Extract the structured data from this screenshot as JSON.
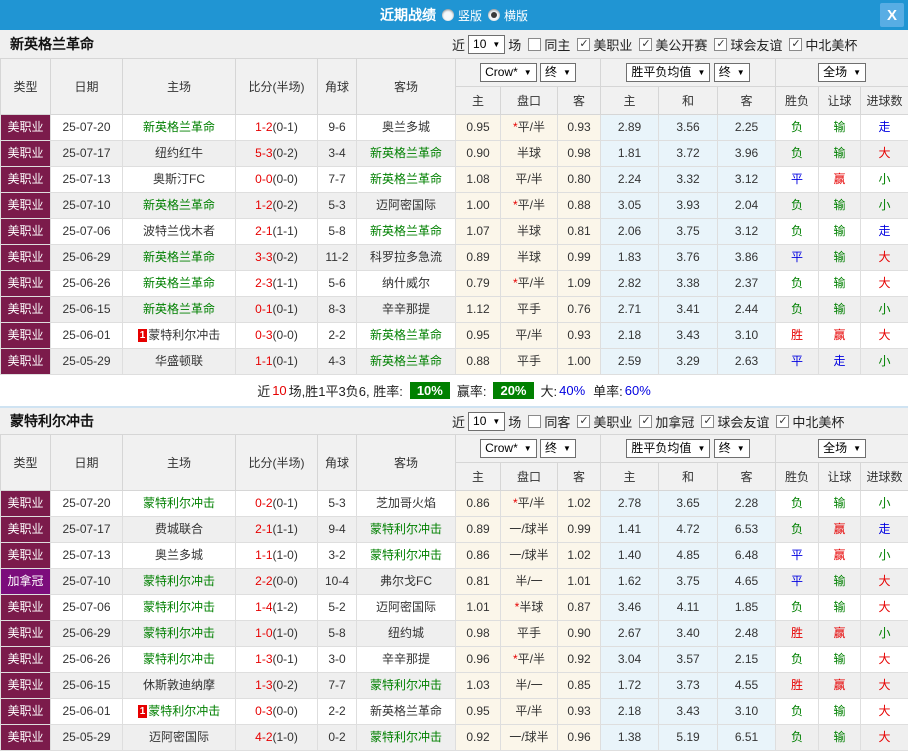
{
  "titlebar": {
    "title": "近期战绩",
    "radios": [
      {
        "label": "竖版",
        "selected": false
      },
      {
        "label": "横版",
        "selected": true
      }
    ],
    "close_label": "X"
  },
  "controls": {
    "bookmaker": "Crow*",
    "asia_final": "终",
    "europe_avg": "胜平负均值",
    "europe_final": "终",
    "scope": "全场"
  },
  "columns": {
    "type": "类型",
    "date": "日期",
    "home": "主场",
    "score": "比分(半场)",
    "corners": "角球",
    "away": "客场",
    "asia_sub": [
      "主",
      "盘口",
      "客"
    ],
    "europe_sub": [
      "主",
      "和",
      "客"
    ],
    "result_sub": [
      "胜负",
      "让球",
      "进球数"
    ]
  },
  "colors": {
    "topbar_blue": "#2095d3",
    "league_maroon": "#7b1b4b",
    "league_purple": "#7c0d7c",
    "team_green": "#008000",
    "score_red": "#e60000",
    "draw_blue": "#0000e0",
    "asia_bg": "#fbf6ea",
    "europe_bg": "#e9f4fa",
    "badge_green": "#008000"
  },
  "sections": [
    {
      "team": "新英格兰革命",
      "filters": {
        "near": "近",
        "count": "10",
        "unit": "场",
        "same_label": "同主",
        "same_checked": false,
        "leagues": [
          {
            "label": "美职业",
            "checked": true
          },
          {
            "label": "美公开赛",
            "checked": true
          },
          {
            "label": "球会友谊",
            "checked": true
          },
          {
            "label": "中北美杯",
            "checked": true
          }
        ]
      },
      "rows": [
        {
          "league": "美职业",
          "lc": "m",
          "date": "25-07-20",
          "home": "新英格兰革命",
          "hg": true,
          "hb": "",
          "away": "奥兰多城",
          "ag": false,
          "score": "1-2",
          "half": "(0-1)",
          "corners": "9-6",
          "ah": "0.95",
          "star": true,
          "line": "平/半",
          "aa": "0.93",
          "eh": "2.89",
          "ed": "3.56",
          "ea": "2.25",
          "res1": "负",
          "c1": "g",
          "res2": "输",
          "c2": "g",
          "res3": "走",
          "c3": "b"
        },
        {
          "league": "美职业",
          "lc": "m",
          "date": "25-07-17",
          "home": "纽约红牛",
          "hg": false,
          "hb": "",
          "away": "新英格兰革命",
          "ag": true,
          "score": "5-3",
          "half": "(0-2)",
          "corners": "3-4",
          "ah": "0.90",
          "star": false,
          "line": "半球",
          "aa": "0.98",
          "eh": "1.81",
          "ed": "3.72",
          "ea": "3.96",
          "res1": "负",
          "c1": "g",
          "res2": "输",
          "c2": "g",
          "res3": "大",
          "c3": "r"
        },
        {
          "league": "美职业",
          "lc": "m",
          "date": "25-07-13",
          "home": "奥斯汀FC",
          "hg": false,
          "hb": "",
          "away": "新英格兰革命",
          "ag": true,
          "score": "0-0",
          "half": "(0-0)",
          "corners": "7-7",
          "ah": "1.08",
          "star": false,
          "line": "平/半",
          "aa": "0.80",
          "eh": "2.24",
          "ed": "3.32",
          "ea": "3.12",
          "res1": "平",
          "c1": "b",
          "res2": "赢",
          "c2": "r",
          "res3": "小",
          "c3": "g"
        },
        {
          "league": "美职业",
          "lc": "m",
          "date": "25-07-10",
          "home": "新英格兰革命",
          "hg": true,
          "hb": "",
          "away": "迈阿密国际",
          "ag": false,
          "score": "1-2",
          "half": "(0-2)",
          "corners": "5-3",
          "ah": "1.00",
          "star": true,
          "line": "平/半",
          "aa": "0.88",
          "eh": "3.05",
          "ed": "3.93",
          "ea": "2.04",
          "res1": "负",
          "c1": "g",
          "res2": "输",
          "c2": "g",
          "res3": "小",
          "c3": "g"
        },
        {
          "league": "美职业",
          "lc": "m",
          "date": "25-07-06",
          "home": "波特兰伐木者",
          "hg": false,
          "hb": "",
          "away": "新英格兰革命",
          "ag": true,
          "score": "2-1",
          "half": "(1-1)",
          "corners": "5-8",
          "ah": "1.07",
          "star": false,
          "line": "半球",
          "aa": "0.81",
          "eh": "2.06",
          "ed": "3.75",
          "ea": "3.12",
          "res1": "负",
          "c1": "g",
          "res2": "输",
          "c2": "g",
          "res3": "走",
          "c3": "b"
        },
        {
          "league": "美职业",
          "lc": "m",
          "date": "25-06-29",
          "home": "新英格兰革命",
          "hg": true,
          "hb": "",
          "away": "科罗拉多急流",
          "ag": false,
          "score": "3-3",
          "half": "(0-2)",
          "corners": "11-2",
          "ah": "0.89",
          "star": false,
          "line": "半球",
          "aa": "0.99",
          "eh": "1.83",
          "ed": "3.76",
          "ea": "3.86",
          "res1": "平",
          "c1": "b",
          "res2": "输",
          "c2": "g",
          "res3": "大",
          "c3": "r"
        },
        {
          "league": "美职业",
          "lc": "m",
          "date": "25-06-26",
          "home": "新英格兰革命",
          "hg": true,
          "hb": "",
          "away": "纳什威尔",
          "ag": false,
          "score": "2-3",
          "half": "(1-1)",
          "corners": "5-6",
          "ah": "0.79",
          "star": true,
          "line": "平/半",
          "aa": "1.09",
          "eh": "2.82",
          "ed": "3.38",
          "ea": "2.37",
          "res1": "负",
          "c1": "g",
          "res2": "输",
          "c2": "g",
          "res3": "大",
          "c3": "r"
        },
        {
          "league": "美职业",
          "lc": "m",
          "date": "25-06-15",
          "home": "新英格兰革命",
          "hg": true,
          "hb": "",
          "away": "辛辛那提",
          "ag": false,
          "score": "0-1",
          "half": "(0-1)",
          "corners": "8-3",
          "ah": "1.12",
          "star": false,
          "line": "平手",
          "aa": "0.76",
          "eh": "2.71",
          "ed": "3.41",
          "ea": "2.44",
          "res1": "负",
          "c1": "g",
          "res2": "输",
          "c2": "g",
          "res3": "小",
          "c3": "g"
        },
        {
          "league": "美职业",
          "lc": "m",
          "date": "25-06-01",
          "home": "蒙特利尔冲击",
          "hg": false,
          "hb": "1",
          "away": "新英格兰革命",
          "ag": true,
          "score": "0-3",
          "half": "(0-0)",
          "corners": "2-2",
          "ah": "0.95",
          "star": false,
          "line": "平/半",
          "aa": "0.93",
          "eh": "2.18",
          "ed": "3.43",
          "ea": "3.10",
          "res1": "胜",
          "c1": "r",
          "res2": "赢",
          "c2": "r",
          "res3": "大",
          "c3": "r"
        },
        {
          "league": "美职业",
          "lc": "m",
          "date": "25-05-29",
          "home": "华盛顿联",
          "hg": false,
          "hb": "",
          "away": "新英格兰革命",
          "ag": true,
          "score": "1-1",
          "half": "(0-1)",
          "corners": "4-3",
          "ah": "0.88",
          "star": false,
          "line": "平手",
          "aa": "1.00",
          "eh": "2.59",
          "ed": "3.29",
          "ea": "2.63",
          "res1": "平",
          "c1": "b",
          "res2": "走",
          "c2": "b",
          "res3": "小",
          "c3": "g"
        }
      ],
      "summary": {
        "lead": "近",
        "count": "10",
        "tail": "场,胜1平3负6, 胜率:",
        "winrate": "10%",
        "profit_label": "赢率:",
        "profit": "20%",
        "big_label": "大:",
        "big_value": "40%",
        "single_label": "单率:",
        "single_value": "60%"
      }
    },
    {
      "team": "蒙特利尔冲击",
      "filters": {
        "near": "近",
        "count": "10",
        "unit": "场",
        "same_label": "同客",
        "same_checked": false,
        "leagues": [
          {
            "label": "美职业",
            "checked": true
          },
          {
            "label": "加拿冠",
            "checked": true
          },
          {
            "label": "球会友谊",
            "checked": true
          },
          {
            "label": "中北美杯",
            "checked": true
          }
        ]
      },
      "rows": [
        {
          "league": "美职业",
          "lc": "m",
          "date": "25-07-20",
          "home": "蒙特利尔冲击",
          "hg": true,
          "hb": "",
          "away": "芝加哥火焰",
          "ag": false,
          "score": "0-2",
          "half": "(0-1)",
          "corners": "5-3",
          "ah": "0.86",
          "star": true,
          "line": "平/半",
          "aa": "1.02",
          "eh": "2.78",
          "ed": "3.65",
          "ea": "2.28",
          "res1": "负",
          "c1": "g",
          "res2": "输",
          "c2": "g",
          "res3": "小",
          "c3": "g"
        },
        {
          "league": "美职业",
          "lc": "m",
          "date": "25-07-17",
          "home": "费城联合",
          "hg": false,
          "hb": "",
          "away": "蒙特利尔冲击",
          "ag": true,
          "score": "2-1",
          "half": "(1-1)",
          "corners": "9-4",
          "ah": "0.89",
          "star": false,
          "line": "一/球半",
          "aa": "0.99",
          "eh": "1.41",
          "ed": "4.72",
          "ea": "6.53",
          "res1": "负",
          "c1": "g",
          "res2": "赢",
          "c2": "r",
          "res3": "走",
          "c3": "b"
        },
        {
          "league": "美职业",
          "lc": "m",
          "date": "25-07-13",
          "home": "奥兰多城",
          "hg": false,
          "hb": "",
          "away": "蒙特利尔冲击",
          "ag": true,
          "score": "1-1",
          "half": "(1-0)",
          "corners": "3-2",
          "ah": "0.86",
          "star": false,
          "line": "一/球半",
          "aa": "1.02",
          "eh": "1.40",
          "ed": "4.85",
          "ea": "6.48",
          "res1": "平",
          "c1": "b",
          "res2": "赢",
          "c2": "r",
          "res3": "小",
          "c3": "g"
        },
        {
          "league": "加拿冠",
          "lc": "p",
          "date": "25-07-10",
          "home": "蒙特利尔冲击",
          "hg": true,
          "hb": "",
          "away": "弗尔戈FC",
          "ag": false,
          "score": "2-2",
          "half": "(0-0)",
          "corners": "10-4",
          "ah": "0.81",
          "star": false,
          "line": "半/一",
          "aa": "1.01",
          "eh": "1.62",
          "ed": "3.75",
          "ea": "4.65",
          "res1": "平",
          "c1": "b",
          "res2": "输",
          "c2": "g",
          "res3": "大",
          "c3": "r"
        },
        {
          "league": "美职业",
          "lc": "m",
          "date": "25-07-06",
          "home": "蒙特利尔冲击",
          "hg": true,
          "hb": "",
          "away": "迈阿密国际",
          "ag": false,
          "score": "1-4",
          "half": "(1-2)",
          "corners": "5-2",
          "ah": "1.01",
          "star": true,
          "line": "半球",
          "aa": "0.87",
          "eh": "3.46",
          "ed": "4.11",
          "ea": "1.85",
          "res1": "负",
          "c1": "g",
          "res2": "输",
          "c2": "g",
          "res3": "大",
          "c3": "r"
        },
        {
          "league": "美职业",
          "lc": "m",
          "date": "25-06-29",
          "home": "蒙特利尔冲击",
          "hg": true,
          "hb": "",
          "away": "纽约城",
          "ag": false,
          "score": "1-0",
          "half": "(1-0)",
          "corners": "5-8",
          "ah": "0.98",
          "star": false,
          "line": "平手",
          "aa": "0.90",
          "eh": "2.67",
          "ed": "3.40",
          "ea": "2.48",
          "res1": "胜",
          "c1": "r",
          "res2": "赢",
          "c2": "r",
          "res3": "小",
          "c3": "g"
        },
        {
          "league": "美职业",
          "lc": "m",
          "date": "25-06-26",
          "home": "蒙特利尔冲击",
          "hg": true,
          "hb": "",
          "away": "辛辛那提",
          "ag": false,
          "score": "1-3",
          "half": "(0-1)",
          "corners": "3-0",
          "ah": "0.96",
          "star": true,
          "line": "平/半",
          "aa": "0.92",
          "eh": "3.04",
          "ed": "3.57",
          "ea": "2.15",
          "res1": "负",
          "c1": "g",
          "res2": "输",
          "c2": "g",
          "res3": "大",
          "c3": "r"
        },
        {
          "league": "美职业",
          "lc": "m",
          "date": "25-06-15",
          "home": "休斯敦迪纳摩",
          "hg": false,
          "hb": "",
          "away": "蒙特利尔冲击",
          "ag": true,
          "score": "1-3",
          "half": "(0-2)",
          "corners": "7-7",
          "ah": "1.03",
          "star": false,
          "line": "半/一",
          "aa": "0.85",
          "eh": "1.72",
          "ed": "3.73",
          "ea": "4.55",
          "res1": "胜",
          "c1": "r",
          "res2": "赢",
          "c2": "r",
          "res3": "大",
          "c3": "r"
        },
        {
          "league": "美职业",
          "lc": "m",
          "date": "25-06-01",
          "home": "蒙特利尔冲击",
          "hg": true,
          "hb": "1",
          "away": "新英格兰革命",
          "ag": false,
          "score": "0-3",
          "half": "(0-0)",
          "corners": "2-2",
          "ah": "0.95",
          "star": false,
          "line": "平/半",
          "aa": "0.93",
          "eh": "2.18",
          "ed": "3.43",
          "ea": "3.10",
          "res1": "负",
          "c1": "g",
          "res2": "输",
          "c2": "g",
          "res3": "大",
          "c3": "r"
        },
        {
          "league": "美职业",
          "lc": "m",
          "date": "25-05-29",
          "home": "迈阿密国际",
          "hg": false,
          "hb": "",
          "away": "蒙特利尔冲击",
          "ag": true,
          "score": "4-2",
          "half": "(1-0)",
          "corners": "0-2",
          "ah": "0.92",
          "star": false,
          "line": "一/球半",
          "aa": "0.96",
          "eh": "1.38",
          "ed": "5.19",
          "ea": "6.51",
          "res1": "负",
          "c1": "g",
          "res2": "输",
          "c2": "g",
          "res3": "大",
          "c3": "r"
        }
      ],
      "summary": null
    }
  ]
}
